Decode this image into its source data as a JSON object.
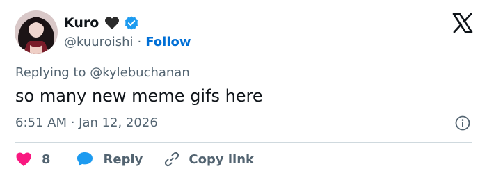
{
  "author": {
    "name": "Kuro",
    "handle": "@kuuroishi",
    "separator": "·",
    "follow_label": "Follow"
  },
  "reply_context": {
    "prefix": "Replying to",
    "mention": "@kylebuchanan"
  },
  "tweet": {
    "text": "so many new meme gifs here",
    "timestamp": "6:51 AM · Jan 12, 2026"
  },
  "actions": {
    "like_count": "8",
    "reply_label": "Reply",
    "copy_link_label": "Copy link"
  },
  "colors": {
    "text_primary": "#0f1419",
    "text_secondary": "#536471",
    "link_blue": "#006fd6",
    "verified_blue": "#1d9bf0",
    "like_pink": "#f91880",
    "divider": "#cfd9de"
  },
  "icons": {
    "emoji": "black-heart-icon",
    "badge": "verified-badge-icon",
    "brand": "x-logo-icon",
    "info": "info-icon",
    "like": "heart-icon",
    "reply": "reply-bubble-icon",
    "copy": "link-icon"
  }
}
